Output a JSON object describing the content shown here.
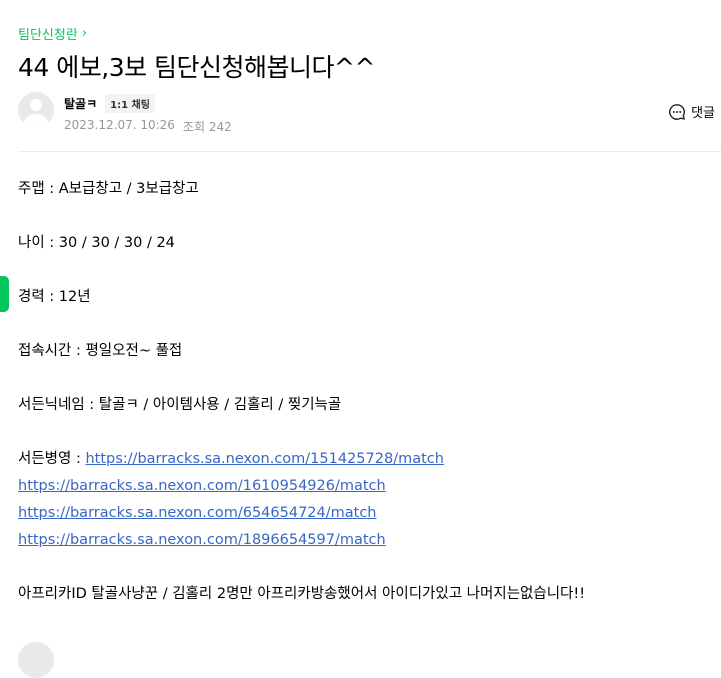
{
  "board": {
    "name": "팀단신청란"
  },
  "post": {
    "title": "44 에보,3보 팀단신청해봅니다^^",
    "author": "탈골ㅋ",
    "chat_badge": "1:1 채팅",
    "date": "2023.12.07. 10:26",
    "views_label": "조회",
    "views": "242",
    "comment_label": "댓글"
  },
  "content": {
    "line1": "주맵 : A보급창고 / 3보급창고",
    "line2": "나이 : 30 / 30 / 30 / 24",
    "line3": "경력 : 12년",
    "line4": "접속시간 : 평일오전~ 풀접",
    "line5": "서든닉네임 : 탈골ㅋ / 아이템사용 / 김홀리 / 찢기늑골",
    "record_label": "서든병영 : ",
    "links": [
      "https://barracks.sa.nexon.com/151425728/match",
      "https://barracks.sa.nexon.com/1610954926/match",
      "https://barracks.sa.nexon.com/654654724/match",
      "https://barracks.sa.nexon.com/1896654597/match"
    ],
    "line_last": "아프리카ID 탈골사냥꾼 / 김홀리 2명만 아프리카방송했어서 아이디가있고 나머지는없습니다!!"
  },
  "colors": {
    "accent": "#03c75a",
    "link": "#3767c6",
    "meta": "#979797"
  },
  "icons": {
    "board_chevron": "chevron-right-icon",
    "comment": "speech-bubble-icon"
  }
}
